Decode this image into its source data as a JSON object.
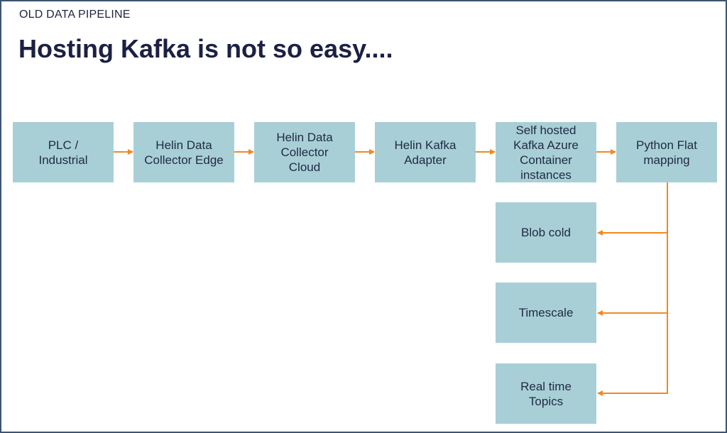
{
  "header": {
    "subtitle": "OLD DATA PIPELINE",
    "title": "Hosting Kafka is not so easy...."
  },
  "colors": {
    "box_fill": "#a8cfd6",
    "arrow": "#f08a24",
    "text": "#1c2043",
    "frame_border": "#3d5472"
  },
  "pipeline": {
    "main_flow": [
      {
        "id": "plc",
        "label": "PLC /\nIndustrial"
      },
      {
        "id": "edge",
        "label": "Helin Data\nCollector Edge"
      },
      {
        "id": "cloud",
        "label": "Helin Data\nCollector\nCloud"
      },
      {
        "id": "adapter",
        "label": "Helin Kafka\nAdapter"
      },
      {
        "id": "kafka",
        "label": "Self hosted\nKafka Azure\nContainer\ninstances"
      },
      {
        "id": "python",
        "label": "Python Flat\nmapping"
      }
    ],
    "outputs": [
      {
        "id": "blob",
        "label": "Blob cold"
      },
      {
        "id": "timescale",
        "label": "Timescale"
      },
      {
        "id": "realtime",
        "label": "Real time\nTopics"
      }
    ],
    "edges": [
      [
        "plc",
        "edge"
      ],
      [
        "edge",
        "cloud"
      ],
      [
        "cloud",
        "adapter"
      ],
      [
        "adapter",
        "kafka"
      ],
      [
        "kafka",
        "python"
      ],
      [
        "python",
        "blob"
      ],
      [
        "python",
        "timescale"
      ],
      [
        "python",
        "realtime"
      ]
    ]
  }
}
